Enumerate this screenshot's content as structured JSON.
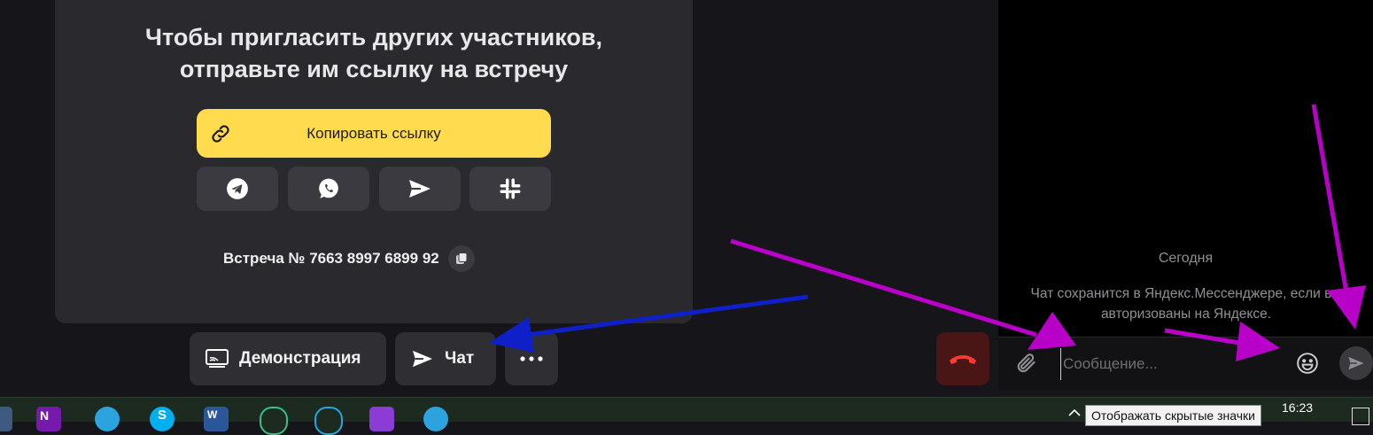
{
  "invite": {
    "title_line1": "Чтобы пригласить других участников,",
    "title_line2": "отправьте им ссылку на встречу",
    "copy_link_label": "Копировать ссылку",
    "share_icons": [
      "telegram-icon",
      "whatsapp-icon",
      "send-icon",
      "slack-icon"
    ],
    "meeting_label": "Встреча № 7663 8997 6899 92"
  },
  "controls": {
    "demo_label": "Демонстрация",
    "chat_label": "Чат"
  },
  "chat": {
    "date_label": "Сегодня",
    "note_line1": "Чат сохранится в Яндекс.Мессенджере, если вы",
    "note_line2": "авторизованы на Яндексе.",
    "input_placeholder": "Сообщение...",
    "input_value": ""
  },
  "taskbar": {
    "apps": [
      "onenote-icon",
      "telegram-icon",
      "skype-icon",
      "word-icon",
      "app-icon",
      "app-icon",
      "app-icon",
      "telegram-icon"
    ],
    "tooltip": "Отображать скрытые значки",
    "clock": "16:23"
  },
  "colors": {
    "accent_yellow": "#ffdb4d",
    "arrow_magenta": "#b800c8",
    "arrow_blue": "#1020c8",
    "hangup_red": "#4a1515"
  }
}
